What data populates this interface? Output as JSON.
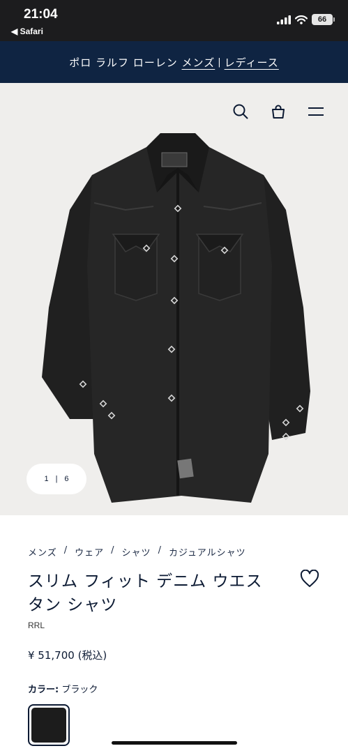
{
  "status_bar": {
    "time": "21:04",
    "back_label": "◀ Safari",
    "battery": "66"
  },
  "brand_bar": {
    "prefix": "ポロ ラルフ ローレン",
    "mens": "メンズ",
    "separator": "|",
    "ladies": "レディース"
  },
  "header_icons": [
    "search-icon",
    "shopping-bag-icon",
    "menu-icon"
  ],
  "gallery": {
    "current": "1",
    "divider": "|",
    "total": "6"
  },
  "breadcrumb": {
    "items": [
      "メンズ",
      "ウェア",
      "シャツ",
      "カジュアルシャツ"
    ],
    "separator": "/"
  },
  "product": {
    "title": "スリム フィット デニム ウエスタン シャツ",
    "brand": "RRL",
    "price": "¥ 51,700 (税込)",
    "color_label": "カラー:",
    "color_value": "ブラック",
    "swatch_color": "#1c1c1c"
  },
  "colors": {
    "banner": "#0f2442",
    "image_bg": "#efeeec",
    "text": "#0c1a33"
  }
}
